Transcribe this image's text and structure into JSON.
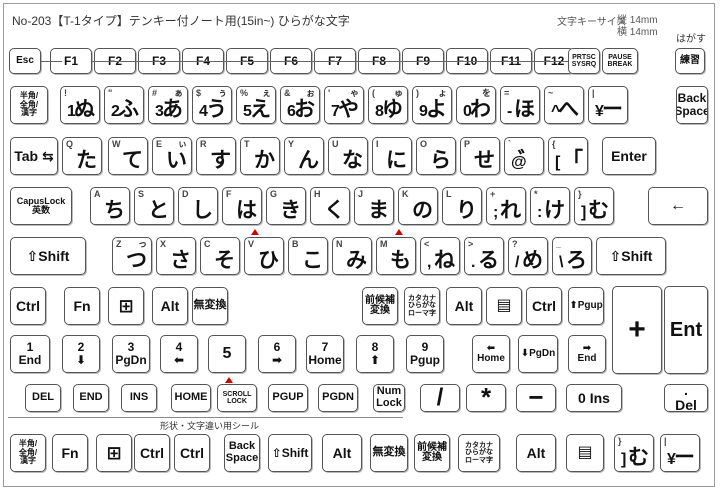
{
  "header": {
    "title": "No-203【T-1タイプ】テンキー付ノート用(15in~)  ひらがな文字",
    "size_label": "文字キーサイズ",
    "height_label": "縦 14mm",
    "width_label": "横 14mm",
    "note": "はがす"
  },
  "shelf_label": "形状・文字違い用シール",
  "rows": [
    {
      "keys": [
        {
          "name": "esc",
          "l": "Esc",
          "fs": 10
        },
        {
          "name": "f1",
          "l": "F1",
          "fs": 12
        },
        {
          "name": "f2",
          "l": "F2",
          "fs": 12
        },
        {
          "name": "f3",
          "l": "F3",
          "fs": 12
        },
        {
          "name": "f4",
          "l": "F4",
          "fs": 12
        },
        {
          "name": "f5",
          "l": "F5",
          "fs": 12
        },
        {
          "name": "f6",
          "l": "F6",
          "fs": 12
        },
        {
          "name": "f7",
          "l": "F7",
          "fs": 12
        },
        {
          "name": "f8",
          "l": "F8",
          "fs": 12
        },
        {
          "name": "f9",
          "l": "F9",
          "fs": 12
        },
        {
          "name": "f10",
          "l": "F10",
          "fs": 12
        },
        {
          "name": "f11",
          "l": "F11",
          "fs": 12
        },
        {
          "name": "f12",
          "l": "F12",
          "fs": 12
        },
        {
          "name": "prtsc",
          "l": "PRTSC\nSYSRQ",
          "fs": 7
        },
        {
          "name": "pause",
          "l": "PAUSE\nBREAK",
          "fs": 7
        },
        {
          "name": "peel",
          "l": "練習",
          "fs": 10
        }
      ]
    },
    {
      "keys": [
        {
          "name": "hankaku",
          "l": "半角/\n全角/\n漢字",
          "fs": 8
        },
        {
          "name": "1",
          "tl": "!",
          "bl": "1",
          "kana": "ぬ"
        },
        {
          "name": "2",
          "tl": "\"",
          "bl": "2",
          "kana": "ふ"
        },
        {
          "name": "3",
          "tl": "#",
          "bl": "3",
          "kana": "あ",
          "tr": "ぁ"
        },
        {
          "name": "4",
          "tl": "$",
          "bl": "4",
          "kana": "う",
          "tr": "ぅ"
        },
        {
          "name": "5",
          "tl": "%",
          "bl": "5",
          "kana": "え",
          "tr": "ぇ"
        },
        {
          "name": "6",
          "tl": "&",
          "bl": "6",
          "kana": "お",
          "tr": "ぉ"
        },
        {
          "name": "7",
          "tl": "'",
          "bl": "7",
          "kana": "や",
          "tr": "ゃ"
        },
        {
          "name": "8",
          "tl": "(",
          "bl": "8",
          "kana": "ゆ",
          "tr": "ゅ"
        },
        {
          "name": "9",
          "tl": ")",
          "bl": "9",
          "kana": "よ",
          "tr": "ょ"
        },
        {
          "name": "0",
          "bl": "0",
          "kana": "わ",
          "tr": "を"
        },
        {
          "name": "minus",
          "tl": "=",
          "bl": "-",
          "kana": "ほ"
        },
        {
          "name": "caret",
          "tl": "~",
          "bl": "^",
          "kana": "へ"
        },
        {
          "name": "yen",
          "tl": "|",
          "bl": "¥",
          "kana": "ー"
        },
        {
          "name": "backspace",
          "l": "Back\nSpace",
          "fs": 12
        }
      ]
    },
    {
      "keys": [
        {
          "name": "tab",
          "l": "Tab ⇆",
          "fs": 14
        },
        {
          "name": "q",
          "tl": "Q",
          "kana": "た"
        },
        {
          "name": "w",
          "tl": "W",
          "kana": "て"
        },
        {
          "name": "e",
          "tl": "E",
          "kana": "い",
          "tr": "ぃ"
        },
        {
          "name": "r",
          "tl": "R",
          "kana": "す"
        },
        {
          "name": "t",
          "tl": "T",
          "kana": "か"
        },
        {
          "name": "y",
          "tl": "Y",
          "kana": "ん"
        },
        {
          "name": "u",
          "tl": "U",
          "kana": "な"
        },
        {
          "name": "i",
          "tl": "I",
          "kana": "に"
        },
        {
          "name": "o",
          "tl": "O",
          "kana": "ら"
        },
        {
          "name": "p",
          "tl": "P",
          "kana": "せ"
        },
        {
          "name": "at",
          "tl": "`",
          "bl": "@",
          "kana": "゛"
        },
        {
          "name": "bracket",
          "tl": "{",
          "bl": "[",
          "kana": "「"
        },
        {
          "name": "enter",
          "l": "Enter",
          "fs": 14
        }
      ]
    },
    {
      "keys": [
        {
          "name": "capslock",
          "l": "CapusLock\n英数",
          "fs": 9
        },
        {
          "name": "a",
          "tl": "A",
          "kana": "ち"
        },
        {
          "name": "s",
          "tl": "S",
          "kana": "と"
        },
        {
          "name": "d",
          "tl": "D",
          "kana": "し"
        },
        {
          "name": "f",
          "tl": "F",
          "kana": "は"
        },
        {
          "name": "g",
          "tl": "G",
          "kana": "き"
        },
        {
          "name": "h",
          "tl": "H",
          "kana": "く"
        },
        {
          "name": "j",
          "tl": "J",
          "kana": "ま"
        },
        {
          "name": "k",
          "tl": "K",
          "kana": "の"
        },
        {
          "name": "l",
          "tl": "L",
          "kana": "り"
        },
        {
          "name": "semicolon",
          "tl": "+",
          "bl": ";",
          "kana": "れ"
        },
        {
          "name": "colon",
          "tl": "*",
          "bl": ":",
          "kana": "け"
        },
        {
          "name": "bracket-close",
          "tl": "}",
          "bl": "]",
          "kana": "む"
        },
        {
          "name": "enter-arrow",
          "l": "←",
          "fs": 16
        }
      ]
    },
    {
      "keys": [
        {
          "name": "shift-left",
          "l": "⇧Shift",
          "fs": 14
        },
        {
          "name": "z",
          "tl": "Z",
          "kana": "つ",
          "tr": "っ"
        },
        {
          "name": "x",
          "tl": "X",
          "kana": "さ"
        },
        {
          "name": "c",
          "tl": "C",
          "kana": "そ"
        },
        {
          "name": "v",
          "tl": "V",
          "kana": "ひ"
        },
        {
          "name": "b",
          "tl": "B",
          "kana": "こ"
        },
        {
          "name": "n",
          "tl": "N",
          "kana": "み"
        },
        {
          "name": "m",
          "tl": "M",
          "kana": "も"
        },
        {
          "name": "comma",
          "tl": "<",
          "bl": ",",
          "kana": "ね"
        },
        {
          "name": "period",
          "tl": ">",
          "bl": ".",
          "kana": "る"
        },
        {
          "name": "slash",
          "tl": "?",
          "bl": "/",
          "kana": "め"
        },
        {
          "name": "backslash",
          "tl": "_",
          "bl": "\\",
          "kana": "ろ"
        },
        {
          "name": "shift-right",
          "l": "⇧Shift",
          "fs": 14
        }
      ]
    },
    {
      "keys": [
        {
          "name": "ctrl-left",
          "l": "Ctrl",
          "fs": 14
        },
        {
          "name": "fn",
          "l": "Fn",
          "fs": 14
        },
        {
          "name": "windows",
          "l": "⊞",
          "fs": 18
        },
        {
          "name": "alt-left",
          "l": "Alt",
          "fs": 14
        },
        {
          "name": "muhenkan",
          "l": "無変換",
          "fs": 11
        },
        {
          "name": "henkan",
          "l": "前候補\n変換",
          "fs": 10
        },
        {
          "name": "katakana",
          "l": "カタカナ\nひらがな\nローマ字",
          "fs": 7
        },
        {
          "name": "alt-right",
          "l": "Alt",
          "fs": 14
        },
        {
          "name": "menu",
          "l": "▤",
          "fs": 16
        },
        {
          "name": "ctrl-right",
          "l": "Ctrl",
          "fs": 14
        },
        {
          "name": "pgup",
          "l": "⬆Pgup",
          "fs": 10
        }
      ]
    },
    {
      "keys": [
        {
          "name": "num1",
          "l": "1\nEnd",
          "fs": 12
        },
        {
          "name": "num2",
          "l": "2\n⬇",
          "fs": 12
        },
        {
          "name": "num3",
          "l": "3\nPgDn",
          "fs": 12
        },
        {
          "name": "num4",
          "l": "4\n⬅",
          "fs": 12
        },
        {
          "name": "num5",
          "l": "5",
          "fs": 16
        },
        {
          "name": "num6",
          "l": "6\n➡",
          "fs": 12
        },
        {
          "name": "num7",
          "l": "7\nHome",
          "fs": 12
        },
        {
          "name": "num8",
          "l": "8\n⬆",
          "fs": 12
        },
        {
          "name": "num9",
          "l": "9\nPgup",
          "fs": 12
        },
        {
          "name": "home-arrow",
          "l": "⬅\nHome",
          "fs": 10
        },
        {
          "name": "pgdn-arrow",
          "l": "⬇PgDn",
          "fs": 10
        },
        {
          "name": "end-arrow",
          "l": "➡\nEnd",
          "fs": 10
        }
      ]
    },
    {
      "keys": [
        {
          "name": "del",
          "l": "DEL",
          "fs": 11
        },
        {
          "name": "end",
          "l": "END",
          "fs": 11
        },
        {
          "name": "ins",
          "l": "INS",
          "fs": 11
        },
        {
          "name": "home",
          "l": "HOME",
          "fs": 11
        },
        {
          "name": "scroll-lock",
          "l": "SCROLL\nLOCK",
          "fs": 7
        },
        {
          "name": "pgup-key",
          "l": "PGUP",
          "fs": 11
        },
        {
          "name": "pgdn-key",
          "l": "PGDN",
          "fs": 11
        },
        {
          "name": "numlock",
          "l": "Num\nLock",
          "fs": 11
        },
        {
          "name": "num-slash",
          "l": "/",
          "fs": 24
        },
        {
          "name": "num-asterisk",
          "l": "*",
          "fs": 26
        },
        {
          "name": "num-minus",
          "l": "−",
          "fs": 26
        },
        {
          "name": "num0",
          "l": "0 Ins",
          "fs": 14
        },
        {
          "name": "num-del",
          "l": ".\nDel",
          "fs": 14
        }
      ]
    },
    {
      "keys": [
        {
          "name": "extra-hankaku",
          "l": "半角/\n全角/\n漢字",
          "fs": 8
        },
        {
          "name": "extra-fn",
          "l": "Fn",
          "fs": 14
        },
        {
          "name": "extra-windows",
          "l": "⊞",
          "fs": 18
        },
        {
          "name": "extra-ctrl-1",
          "l": "Ctrl",
          "fs": 14
        },
        {
          "name": "extra-ctrl-2",
          "l": "Ctrl",
          "fs": 14
        },
        {
          "name": "extra-backspace",
          "l": "Back\nSpace",
          "fs": 11
        },
        {
          "name": "extra-shift",
          "l": "⇧Shift",
          "fs": 12
        },
        {
          "name": "extra-alt-1",
          "l": "Alt",
          "fs": 14
        },
        {
          "name": "extra-muhenkan",
          "l": "無変換",
          "fs": 11
        },
        {
          "name": "extra-henkan",
          "l": "前候補\n変換",
          "fs": 10
        },
        {
          "name": "extra-katakana",
          "l": "カタカナ\nひらがな\nローマ字",
          "fs": 7
        },
        {
          "name": "extra-alt-2",
          "l": "Alt",
          "fs": 14
        },
        {
          "name": "extra-menu",
          "l": "▤",
          "fs": 16
        },
        {
          "name": "extra-bracket",
          "tl": "}",
          "bl": "]",
          "kana": "む"
        },
        {
          "name": "extra-yen",
          "tl": "|",
          "bl": "¥",
          "kana": "ー"
        }
      ]
    },
    {
      "keys": [
        {
          "name": "num-plus",
          "l": "+",
          "fs": 30
        },
        {
          "name": "num-enter",
          "l": "Ent",
          "fs": 20
        }
      ]
    }
  ]
}
